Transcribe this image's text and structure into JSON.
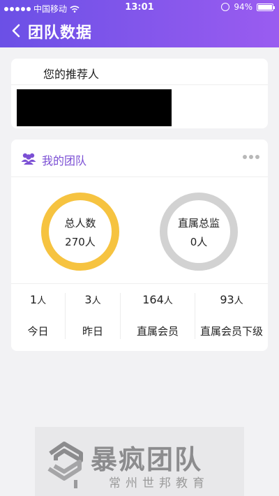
{
  "status_bar": {
    "carrier": "中国移动",
    "time": "13:01",
    "battery": "94%"
  },
  "nav": {
    "title": "团队数据"
  },
  "referrer": {
    "label": "您的推荐人"
  },
  "team": {
    "title": "我的团队",
    "total": {
      "label": "总人数",
      "value": "270人"
    },
    "direct_director": {
      "label": "直属总监",
      "value": "0人"
    },
    "stats": [
      {
        "num": "1",
        "unit": "人",
        "label": "今日"
      },
      {
        "num": "3",
        "unit": "人",
        "label": "昨日"
      },
      {
        "num": "164",
        "unit": "人",
        "label": "直属会员"
      },
      {
        "num": "93",
        "unit": "人",
        "label": "直属会员下级"
      }
    ]
  },
  "watermark": {
    "title": "暴疯团队",
    "subtitle": "常州世邦教育"
  },
  "colors": {
    "header_start": "#6b50e6",
    "header_end": "#9a5cf0",
    "accent": "#7b4fd4",
    "ring_total": "#f6c340",
    "ring_director": "#d2d2d2"
  }
}
